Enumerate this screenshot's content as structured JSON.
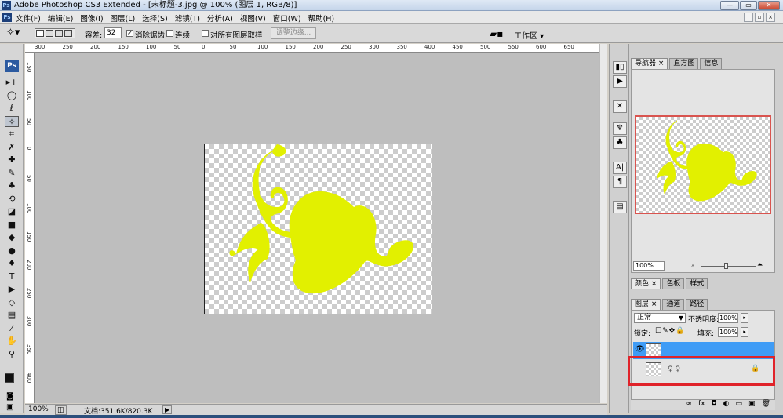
{
  "window": {
    "app_badge": "Ps",
    "title": "Adobe Photoshop CS3 Extended - [未标题-3.jpg @ 100% (图层 1, RGB/8)]",
    "controls": [
      "—",
      "▭",
      "✕"
    ]
  },
  "menubar": {
    "items": [
      "文件(F)",
      "编辑(E)",
      "图像(I)",
      "图层(L)",
      "选择(S)",
      "滤镜(T)",
      "分析(A)",
      "视图(V)",
      "窗口(W)",
      "帮助(H)"
    ],
    "doc_controls": [
      "_",
      "▫",
      "×"
    ]
  },
  "optionsbar": {
    "tolerance_label": "容差:",
    "tolerance_value": "32",
    "antialias_label": "消除锯齿",
    "antialias_checked": true,
    "contiguous_label": "连续",
    "contiguous_checked": false,
    "sample_all_label": "对所有图层取样",
    "sample_all_checked": false,
    "refine_edge_label": "调整边缘...",
    "workspace_label": "工作区 ▾"
  },
  "ruler": {
    "top_ticks": [
      "300",
      "250",
      "200",
      "150",
      "100",
      "50",
      "0",
      "50",
      "100",
      "150",
      "200",
      "250",
      "300",
      "350",
      "400",
      "450",
      "500",
      "550",
      "600",
      "650"
    ],
    "left_ticks": [
      "150",
      "100",
      "50",
      "0",
      "50",
      "100",
      "150",
      "200",
      "250",
      "300",
      "350",
      "400"
    ]
  },
  "toolbox": {
    "ps_label": "Ps",
    "tools": [
      {
        "icon": "move-icon",
        "glyph": "▸+"
      },
      {
        "icon": "marquee-ellipse-icon",
        "glyph": "◯"
      },
      {
        "icon": "lasso-icon",
        "glyph": "ℓ"
      },
      {
        "icon": "magic-wand-icon",
        "glyph": "✧"
      },
      {
        "icon": "crop-icon",
        "glyph": "⌗"
      },
      {
        "icon": "slice-icon",
        "glyph": "✗"
      },
      {
        "icon": "healing-brush-icon",
        "glyph": "✚"
      },
      {
        "icon": "brush-icon",
        "glyph": "✎"
      },
      {
        "icon": "clone-stamp-icon",
        "glyph": "♣"
      },
      {
        "icon": "history-brush-icon",
        "glyph": "⟲"
      },
      {
        "icon": "eraser-icon",
        "glyph": "◪"
      },
      {
        "icon": "gradient-icon",
        "glyph": "■"
      },
      {
        "icon": "blur-icon",
        "glyph": "◆"
      },
      {
        "icon": "dodge-icon",
        "glyph": "●"
      },
      {
        "icon": "pen-icon",
        "glyph": "♦"
      },
      {
        "icon": "type-icon",
        "glyph": "T"
      },
      {
        "icon": "path-selection-icon",
        "glyph": "▶"
      },
      {
        "icon": "shape-icon",
        "glyph": "◇"
      },
      {
        "icon": "notes-icon",
        "glyph": "▤"
      },
      {
        "icon": "eyedropper-icon",
        "glyph": "⁄"
      },
      {
        "icon": "hand-icon",
        "glyph": "✋"
      },
      {
        "icon": "zoom-icon",
        "glyph": "⚲"
      }
    ],
    "quickmask_glyph": "◙",
    "screenmode_glyph": "▣"
  },
  "statusbar": {
    "zoom": "100%",
    "doc_info": "文档:351.6K/820.3K",
    "arrow": "▶"
  },
  "dock": {
    "buttons": [
      {
        "icon": "histogram-icon",
        "glyph": "▮▯"
      },
      {
        "icon": "actions-play-icon",
        "glyph": "▶"
      },
      {
        "icon": "tools-crossed-icon",
        "glyph": "✕"
      },
      {
        "icon": "brushes-icon",
        "glyph": "♆"
      },
      {
        "icon": "clone-source-icon",
        "glyph": "♣"
      },
      {
        "icon": "character-icon",
        "glyph": "A|"
      },
      {
        "icon": "paragraph-icon",
        "glyph": "¶"
      },
      {
        "icon": "layer-comps-icon",
        "glyph": "▤"
      }
    ]
  },
  "navigator_panel": {
    "tabs": [
      "导航器 ×",
      "直方图",
      "信息"
    ],
    "zoom_value": "100%",
    "zoom_out_glyph": "▵",
    "zoom_in_glyph": "⏶"
  },
  "color_panel": {
    "tabs": [
      "颜色 ×",
      "色板",
      "样式"
    ]
  },
  "layers_panel": {
    "tabs": [
      "图层 ×",
      "通道",
      "路径"
    ],
    "blend_mode": "正常",
    "opacity_label": "不透明度:",
    "opacity_value": "100%",
    "lock_label": "锁定:",
    "fill_label": "填充:",
    "fill_value": "100%",
    "layers": [
      {
        "name": "",
        "visible": true,
        "selected": true
      },
      {
        "name": "",
        "visible": false,
        "selected": false,
        "locked": true
      }
    ],
    "bottom_icons": [
      "link-icon",
      "fx-icon",
      "mask-icon",
      "adjustment-icon",
      "group-icon",
      "new-layer-icon",
      "trash-icon"
    ],
    "bottom_glyphs": [
      "∞",
      "fx",
      "◘",
      "◐",
      "▭",
      "▣",
      "🗑"
    ]
  },
  "colors": {
    "artwork": "#e2f000",
    "selection_blue": "#3f9cf6",
    "highlight_red": "#e0232a"
  }
}
